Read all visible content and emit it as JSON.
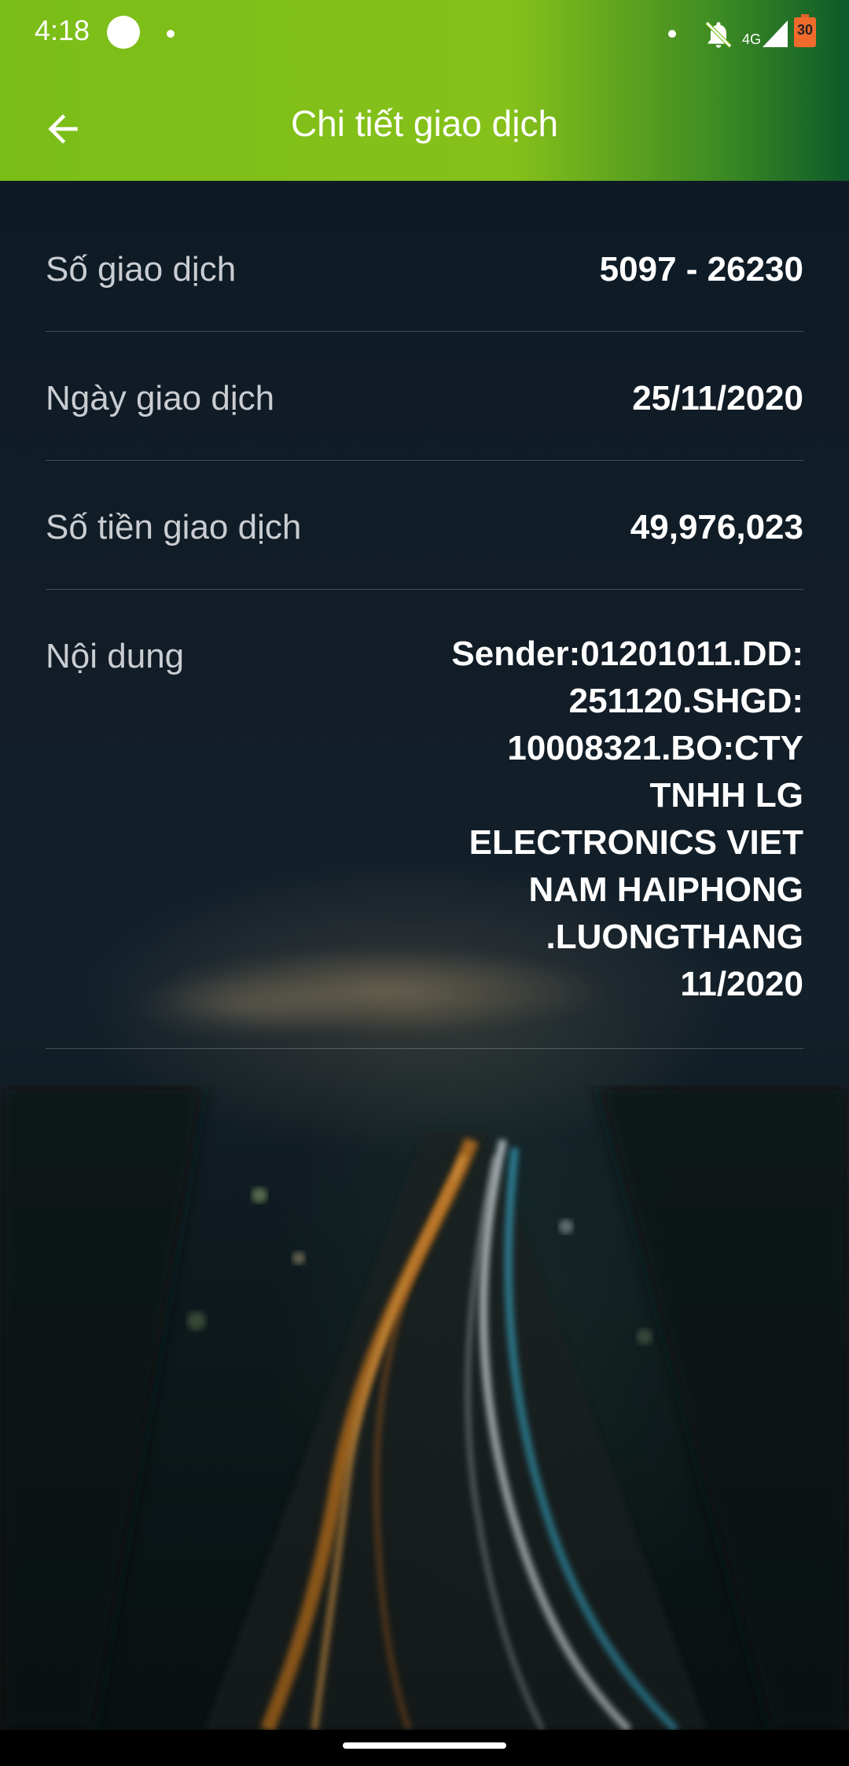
{
  "status_bar": {
    "time": "4:18",
    "network": "4G",
    "battery": "30",
    "icons": [
      "notification-circle-icon",
      "dot-icon",
      "bell-off-icon",
      "signal-icon",
      "battery-icon"
    ]
  },
  "app_bar": {
    "title": "Chi tiết giao dịch",
    "back_icon": "arrow-left-icon"
  },
  "details": {
    "transaction_number": {
      "label": "Số giao dịch",
      "value": "5097 - 26230"
    },
    "transaction_date": {
      "label": "Ngày giao dịch",
      "value": "25/11/2020"
    },
    "transaction_amount": {
      "label": "Số tiền giao dịch",
      "value": "49,976,023"
    },
    "content": {
      "label": "Nội dung",
      "value": "Sender:01201011.DD: 251120.SHGD: 10008321.BO:CTY TNHH LG ELECTRONICS VIET NAM HAIPHONG .LUONGTHANG 11/2020"
    }
  },
  "colors": {
    "header_start": "#7bbd18",
    "header_end": "#0e5a2a",
    "label": "#c9cdd1",
    "value": "#ffffff"
  }
}
